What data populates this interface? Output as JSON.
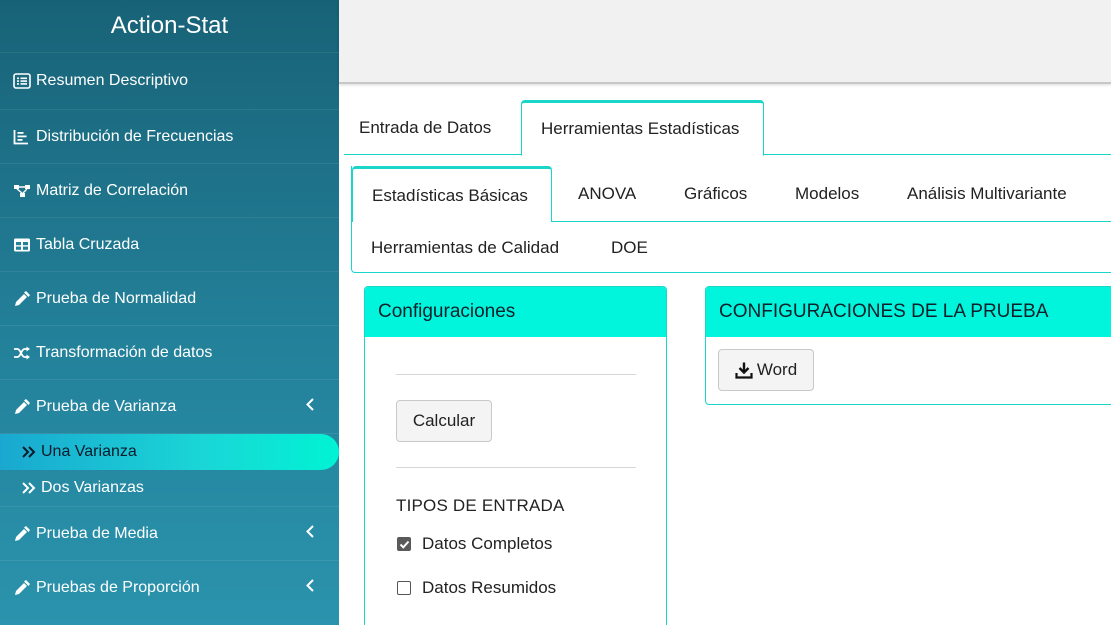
{
  "app": {
    "title": "Action-Stat"
  },
  "sidebar": {
    "items": [
      {
        "label": "Resumen Descriptivo",
        "icon": "list-icon"
      },
      {
        "label": "Distribución de Frecuencias",
        "icon": "bar-chart-icon"
      },
      {
        "label": "Matriz de Correlación",
        "icon": "network-icon"
      },
      {
        "label": "Tabla Cruzada",
        "icon": "table-icon"
      },
      {
        "label": "Prueba de Normalidad",
        "icon": "eyedropper-icon"
      },
      {
        "label": "Transformación de datos",
        "icon": "shuffle-icon"
      },
      {
        "label": "Prueba de Varianza",
        "icon": "eyedropper-icon",
        "expanded": true
      },
      {
        "label": "Prueba de Media",
        "icon": "eyedropper-icon"
      },
      {
        "label": "Pruebas de Proporción",
        "icon": "eyedropper-icon"
      }
    ],
    "subitems": [
      {
        "label": "Una Varianza",
        "active": true
      },
      {
        "label": "Dos Varianzas",
        "active": false
      }
    ]
  },
  "tabs": {
    "main": [
      "Entrada de Datos",
      "Herramientas Estadísticas"
    ],
    "active_main": "Herramientas Estadísticas",
    "sub": [
      "Estadísticas Básicas",
      "ANOVA",
      "Gráficos",
      "Modelos",
      "Análisis Multivariante",
      "Herramientas de Calidad",
      "DOE"
    ],
    "active_sub": "Estadísticas Básicas"
  },
  "config": {
    "title": "Configuraciones",
    "calc_button": "Calcular",
    "input_types_title": "TIPOS DE ENTRADA",
    "options": [
      {
        "label": "Datos Completos",
        "checked": true
      },
      {
        "label": "Datos Resumidos",
        "checked": false
      }
    ]
  },
  "test_config": {
    "title": "CONFIGURACIONES DE LA PRUEBA",
    "word_button": "Word"
  },
  "colors": {
    "sidebar_top": "#186277",
    "sidebar_bottom": "#2b93ad",
    "accent": "#00f5dc",
    "border_accent": "#1ad6c9"
  }
}
